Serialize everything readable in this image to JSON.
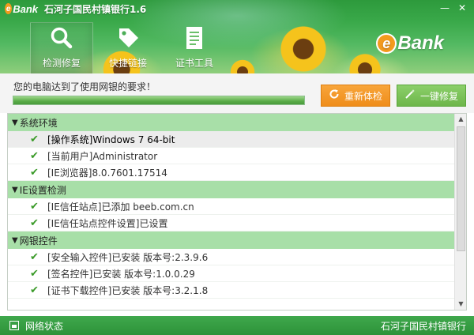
{
  "window": {
    "title": "石河子国民村镇银行1.6",
    "logo_text": "Bank",
    "logo_letter": "e",
    "minimize": "—",
    "close": "✕"
  },
  "nav": {
    "items": [
      {
        "label": "检测修复",
        "icon": "magnifier-icon",
        "active": true
      },
      {
        "label": "快捷链接",
        "icon": "tag-icon",
        "active": false
      },
      {
        "label": "证书工具",
        "icon": "document-icon",
        "active": false
      }
    ]
  },
  "brand": {
    "logo_text": "Bank",
    "logo_letter": "e"
  },
  "status": {
    "message": "您的电脑达到了使用网银的要求！",
    "progress": 1.0,
    "recheck_label": "重新体检",
    "repair_label": "一键修复"
  },
  "list": {
    "categories": [
      {
        "name": "系统环境",
        "items": [
          "[操作系统]Windows 7 64-bit",
          "[当前用户]Administrator",
          "[IE浏览器]8.0.7601.17514"
        ]
      },
      {
        "name": "IE设置检测",
        "items": [
          "[IE信任站点]已添加 beeb.com.cn",
          "[IE信任站点控件设置]已设置"
        ]
      },
      {
        "name": "网银控件",
        "items": [
          "[安全输入控件]已安装 版本号:2.3.9.6",
          "[签名控件]已安装 版本号:1.0.0.29",
          "[证书下载控件]已安装 版本号:3.2.1.8"
        ]
      }
    ]
  },
  "footer": {
    "network_status": "网络状态",
    "bank_name": "石河子国民村镇银行"
  },
  "colors": {
    "header_green": "#3aa94a",
    "category_green": "#a8dfa8",
    "orange_button": "#ef8d1a",
    "green_button": "#6db64a",
    "check_green": "#3a9a28"
  }
}
